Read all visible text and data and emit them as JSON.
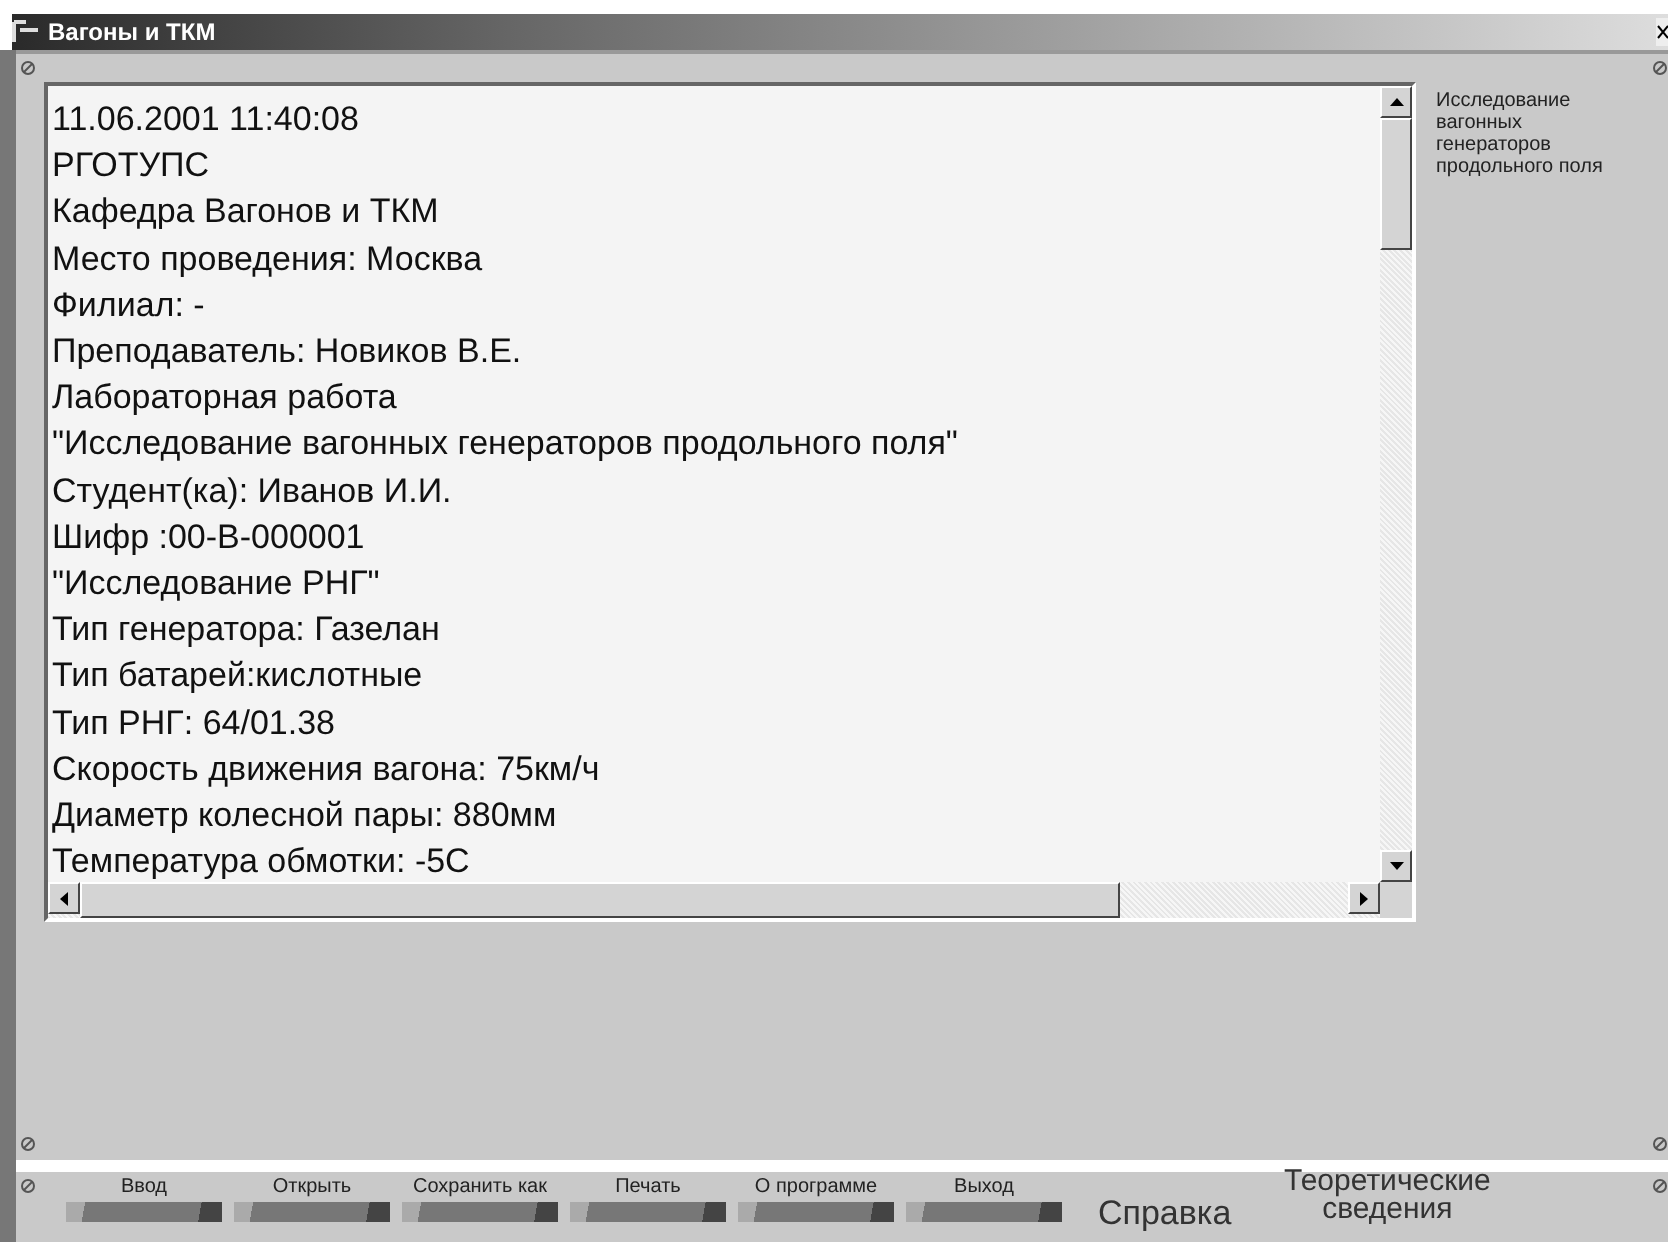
{
  "window": {
    "title": "Вагоны и ТКМ"
  },
  "report": {
    "lines": [
      "11.06.2001 11:40:08",
      "РГОТУПС",
      "Кафедра Вагонов и ТКМ",
      "Место проведения: Москва",
      "Филиал: -",
      "Преподаватель: Новиков В.Е.",
      "Лабораторная работа",
      "\"Исследование вагонных генераторов продольного поля\"",
      "Студент(ка): Иванов И.И.",
      "Шифр :00-В-000001",
      "\"Исследование РНГ\"",
      "Тип генератора: Газелан",
      "Тип батарей:кислотные",
      "Тип РНГ: 64/01.38",
      "Скорость движения вагона: 75км/ч",
      "Диаметр колесной пары: 880мм",
      "Температура обмотки: -5С"
    ]
  },
  "side_note": "Исследование вагонных генераторов продольного поля",
  "toolbar": {
    "buttons": [
      {
        "label": "Ввод"
      },
      {
        "label": "Открыть"
      },
      {
        "label": "Сохранить как"
      },
      {
        "label": "Печать"
      },
      {
        "label": "О программе"
      },
      {
        "label": "Выход"
      }
    ],
    "links": [
      "Справка",
      "Теоретические сведения"
    ]
  }
}
